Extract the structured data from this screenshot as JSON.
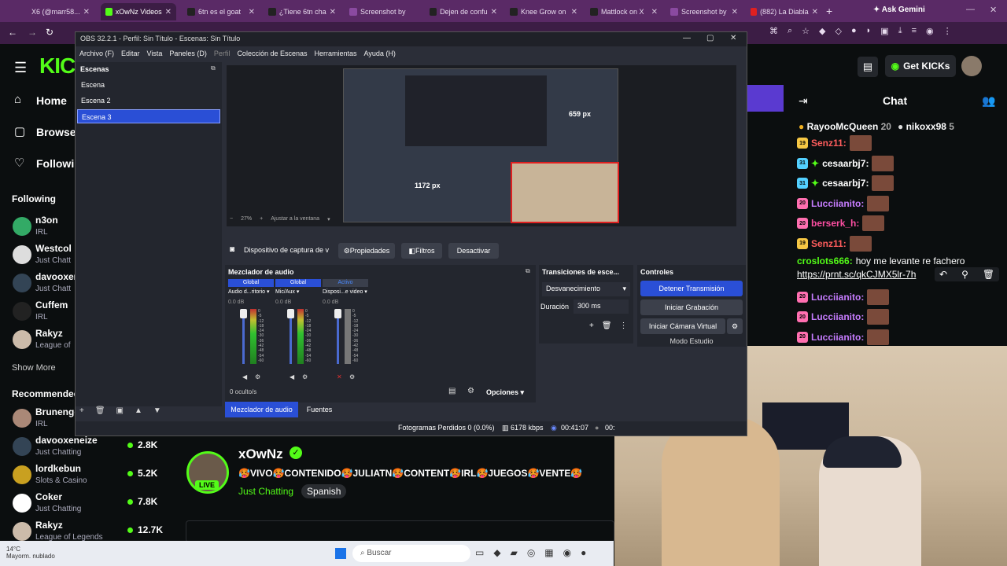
{
  "browser": {
    "tabs": [
      {
        "label": "X6 (@marr58..."
      },
      {
        "label": "xOwNz Videos"
      },
      {
        "label": "6tn es el goat"
      },
      {
        "label": "¿Tiene 6tn cha"
      },
      {
        "label": "Screenshot by"
      },
      {
        "label": "Dejen de confu"
      },
      {
        "label": "Knee Grow on"
      },
      {
        "label": "Mattlock on X"
      },
      {
        "label": "Screenshot by"
      },
      {
        "label": "(882) La Diabla"
      }
    ],
    "ask_gemini": "Ask Gemini"
  },
  "kick": {
    "logo": "KIC",
    "nav": {
      "home": "Home",
      "browse": "Browse",
      "following": "Followin"
    },
    "following_title": "Following",
    "following": [
      {
        "name": "n3on",
        "category": "IRL"
      },
      {
        "name": "Westcol",
        "category": "Just Chatt"
      },
      {
        "name": "davooxer",
        "category": "Just Chatt"
      },
      {
        "name": "Cuffem",
        "category": "IRL"
      },
      {
        "name": "Rakyz",
        "category": "League of"
      }
    ],
    "show_more": "Show More",
    "recommended_title": "Recommended",
    "recommended": [
      {
        "name": "Brunenge",
        "category": "IRL",
        "viewers": ""
      },
      {
        "name": "davooxeneize",
        "category": "Just Chatting",
        "viewers": "2.8K"
      },
      {
        "name": "lordkebun",
        "category": "Slots & Casino",
        "viewers": "5.2K"
      },
      {
        "name": "Coker",
        "category": "Just Chatting",
        "viewers": "7.8K"
      },
      {
        "name": "Rakyz",
        "category": "League of Legends",
        "viewers": "12.7K"
      }
    ],
    "get_kicks": "Get KICKs",
    "streamer": {
      "name": "xOwNz",
      "title": "🥵VIVO🥵CONTENIDO🥵JULIATN🥵CONTENT🥵IRL🥵JUEGOS🥵VENTE🥵",
      "category": "Just Chatting",
      "language": "Spanish",
      "live": "LIVE"
    },
    "weather": {
      "temp": "14°C",
      "desc": "Mayorm. nublado"
    }
  },
  "chat": {
    "title": "Chat",
    "top_gifters": [
      {
        "name": "RayooMcQueen",
        "count": "20"
      },
      {
        "name": "nikoxx98",
        "count": "5"
      }
    ],
    "messages": [
      {
        "badge": "19",
        "user": "Senz11:",
        "text": "",
        "color": "#ff5d5d"
      },
      {
        "badge": "31",
        "user": "cesaarbj7:",
        "text": "",
        "color": "#ffffff"
      },
      {
        "badge": "31",
        "user": "cesaarbj7:",
        "text": "",
        "color": "#ffffff"
      },
      {
        "badge": "20",
        "user": "Lucciianito:",
        "text": "",
        "color": "#c77dff"
      },
      {
        "badge": "20",
        "user": "berserk_h:",
        "text": "",
        "color": "#ff4fa3"
      },
      {
        "badge": "19",
        "user": "Senz11:",
        "text": "",
        "color": "#ff5d5d"
      },
      {
        "badge": "",
        "user": "croslots666:",
        "text": "hoy me levante re fachero",
        "color": "#53fc18"
      },
      {
        "badge": "",
        "user": "",
        "text": "https://prnt.sc/qkCJMX5lr-7h",
        "color": "#ffffff"
      },
      {
        "badge": "20",
        "user": "Lucciianito:",
        "text": "",
        "color": "#c77dff"
      },
      {
        "badge": "20",
        "user": "Lucciianito:",
        "text": "",
        "color": "#c77dff"
      },
      {
        "badge": "20",
        "user": "Lucciianito:",
        "text": "",
        "color": "#c77dff"
      }
    ]
  },
  "obs": {
    "window_title": "OBS 32.2.1 - Perfil: Sin Título - Escenas: Sin Título",
    "menu": [
      "Archivo (F)",
      "Editar",
      "Vista",
      "Paneles (D)",
      "Perfil",
      "Colección de Escenas",
      "Herramientas",
      "Ayuda (H)"
    ],
    "scenes_title": "Escenas",
    "scenes": [
      "Escena",
      "Escena 2",
      "Escena 3"
    ],
    "preview": {
      "zoom": "27%",
      "fit": "Ajustar a la ventana",
      "dim_w": "1172 px",
      "dim_h": "659 px"
    },
    "source_bar": {
      "source": "Dispositivo de captura de v",
      "properties": "Propiedades",
      "filters": "Filtros",
      "deactivate": "Desactivar"
    },
    "mixer": {
      "title": "Mezclador de audio",
      "channels": [
        {
          "tag": "Global",
          "name": "Audio d...ritorio",
          "db": "0.0 dB"
        },
        {
          "tag": "Global",
          "name": "Mic/Aux",
          "db": "0.0 dB"
        },
        {
          "tag": "Activo",
          "name": "Disposi...e video",
          "db": "0.0 dB"
        }
      ],
      "hidden": "0 oculto/s",
      "options": "Opciones",
      "scale": [
        "0",
        "-5",
        "-12",
        "-18",
        "-24",
        "-30",
        "-36",
        "-42",
        "-48",
        "-54",
        "-60"
      ]
    },
    "transitions": {
      "title": "Transiciones de esce...",
      "type": "Desvanecimiento",
      "duration_label": "Duración",
      "duration": "300 ms"
    },
    "controls": {
      "title": "Controles",
      "stop": "Detener Transmisión",
      "record": "Iniciar Grabación",
      "virtual_cam": "Iniciar Cámara Virtual",
      "studio": "Modo Estudio"
    },
    "tabs": {
      "mixer": "Mezclador de audio",
      "sources": "Fuentes"
    },
    "status": {
      "frames": "Fotogramas Perdidos 0 (0.0%)",
      "bitrate": "6178 kbps",
      "time": "00:41:07",
      "rec": "00:"
    }
  },
  "taskbar": {
    "search": "Buscar"
  },
  "colors": {
    "kick_green": "#53fc18",
    "obs_blue": "#2a4fd6",
    "browser_tab": "#5a2a66"
  }
}
